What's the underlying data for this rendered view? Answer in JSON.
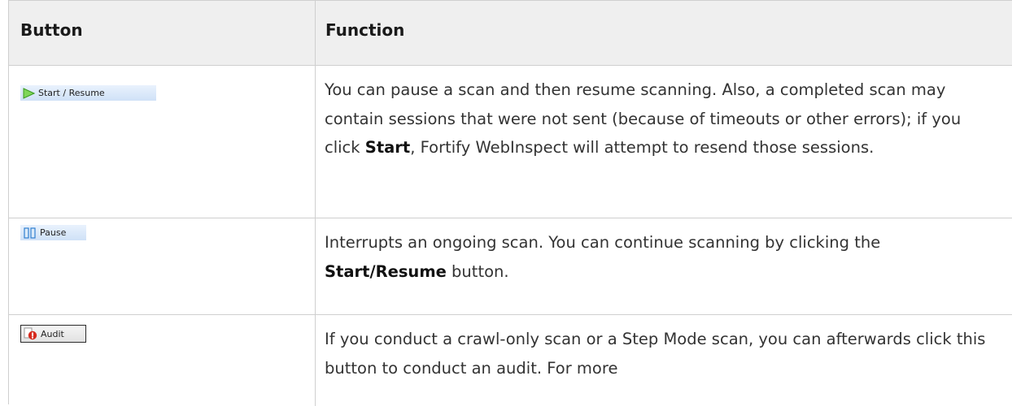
{
  "table": {
    "headers": {
      "button": "Button",
      "function": "Function"
    },
    "rows": [
      {
        "button_label": "Start / Resume",
        "button_icon": "play-arrow-icon",
        "function_parts": [
          "You can pause a scan and then resume scanning. Also, a completed scan may contain sessions that were not sent (because of timeouts or other errors); if you click ",
          "Start",
          ", Fortify WebInspect will attempt to resend those sessions."
        ]
      },
      {
        "button_label": "Pause",
        "button_icon": "pause-icon",
        "function_parts": [
          "Interrupts an ongoing scan. You can continue scanning by clicking the ",
          "Start/Resume",
          " button."
        ]
      },
      {
        "button_label": "Audit",
        "button_icon": "audit-icon",
        "function_parts": [
          "If you conduct a crawl-only scan or a Step Mode scan, you can afterwards click this button to conduct an audit. For more"
        ]
      }
    ]
  },
  "colors": {
    "header_bg": "#efefef",
    "border": "#cfcfcf",
    "text": "#333333",
    "play_green": "#5cc53a",
    "pause_blue": "#2f7fd0",
    "audit_red": "#d62a1e"
  }
}
